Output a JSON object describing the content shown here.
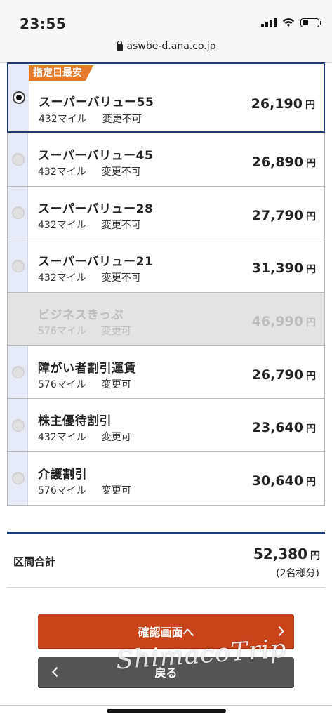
{
  "status_bar": {
    "time": "23:55"
  },
  "browser": {
    "url": "aswbe-d.ana.co.jp"
  },
  "fares": [
    {
      "badge": "指定日最安",
      "name": "スーパーバリュー55",
      "miles": "432マイル",
      "change": "変更不可",
      "price": "26,190",
      "yen": "円",
      "selected": true,
      "disabled": false
    },
    {
      "name": "スーパーバリュー45",
      "miles": "432マイル",
      "change": "変更不可",
      "price": "26,890",
      "yen": "円",
      "selected": false,
      "disabled": false
    },
    {
      "name": "スーパーバリュー28",
      "miles": "432マイル",
      "change": "変更不可",
      "price": "27,790",
      "yen": "円",
      "selected": false,
      "disabled": false
    },
    {
      "name": "スーパーバリュー21",
      "miles": "432マイル",
      "change": "変更不可",
      "price": "31,390",
      "yen": "円",
      "selected": false,
      "disabled": false
    },
    {
      "name": "ビジネスきっぷ",
      "miles": "576マイル",
      "change": "変更可",
      "price": "46,990",
      "yen": "円",
      "selected": false,
      "disabled": true
    },
    {
      "name": "障がい者割引運賃",
      "miles": "576マイル",
      "change": "変更可",
      "price": "26,790",
      "yen": "円",
      "selected": false,
      "disabled": false
    },
    {
      "name": "株主優待割引",
      "miles": "432マイル",
      "change": "変更可",
      "price": "23,640",
      "yen": "円",
      "selected": false,
      "disabled": false
    },
    {
      "name": "介護割引",
      "miles": "576マイル",
      "change": "変更可",
      "price": "30,640",
      "yen": "円",
      "selected": false,
      "disabled": false
    }
  ],
  "total": {
    "label": "区間合計",
    "amount": "52,380",
    "yen": "円",
    "note": "(2名様分)"
  },
  "buttons": {
    "confirm": "確認画面へ",
    "back": "戻る"
  },
  "watermark": "ShimacoTrip",
  "colors": {
    "accent": "#c9441b",
    "navy": "#1f3a73",
    "badge": "#e67a2b"
  }
}
